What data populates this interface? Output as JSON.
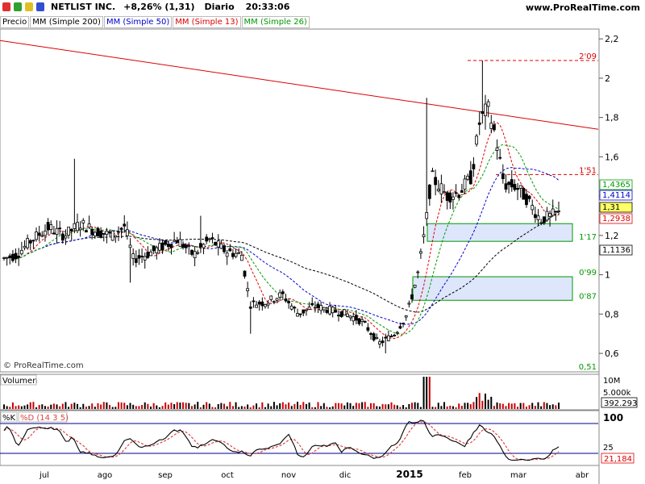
{
  "header": {
    "ticker": "NETLIST INC.",
    "change": "+8,26% (1,31)",
    "period": "Diario",
    "time": "20:33:06",
    "site": "www.ProRealTime.com",
    "icon_colors": [
      "#e03030",
      "#30a030",
      "#e0c020",
      "#3050d0"
    ]
  },
  "legend": [
    {
      "label": "Precio",
      "color": "#000000"
    },
    {
      "label": "MM (Simple 200)",
      "color": "#000000"
    },
    {
      "label": "MM (Simple 50)",
      "color": "#0000cc"
    },
    {
      "label": "MM (Simple 13)",
      "color": "#dd0000"
    },
    {
      "label": "MM (Simple 26)",
      "color": "#009900"
    }
  ],
  "watermark": "© ProRealTime.com",
  "chart_data": [
    {
      "type": "candlestick",
      "panel": "price",
      "y_ticks": [
        "0,6",
        "0,8",
        "1",
        "1,2",
        "1,4",
        "1,6",
        "1,8",
        "2",
        "2,2"
      ],
      "y_tick_values": [
        0.6,
        0.8,
        1.0,
        1.2,
        1.4,
        1.6,
        1.8,
        2.0,
        2.2
      ],
      "ylim": [
        0.51,
        2.25
      ],
      "x_labels": [
        "jul",
        "ago",
        "sep",
        "oct",
        "nov",
        "dic",
        "2015",
        "feb",
        "mar",
        "abr"
      ],
      "ohlc_approx": {
        "start_month": "jun",
        "segments": [
          {
            "label": "jun-jul",
            "range": [
              1.05,
              1.3
            ]
          },
          {
            "label": "ago",
            "range": [
              0.95,
              1.35
            ]
          },
          {
            "label": "sep-oct",
            "range": [
              0.7,
              1.25
            ]
          },
          {
            "label": "nov-dic",
            "range": [
              0.6,
              0.95
            ]
          },
          {
            "label": "ene",
            "range": [
              0.9,
              1.9
            ]
          },
          {
            "label": "feb",
            "range": [
              1.4,
              2.09
            ]
          },
          {
            "label": "mar",
            "range": [
              1.17,
              1.5
            ]
          }
        ],
        "last": 1.31,
        "high": 2.09
      },
      "price_labels": [
        {
          "text": "1,4365",
          "value": 1.4365,
          "color": "#009900",
          "style": "box"
        },
        {
          "text": "1,4114",
          "value": 1.4114,
          "color": "#0000cc",
          "style": "box"
        },
        {
          "text": "1,31",
          "value": 1.31,
          "color": "#000000",
          "style": "box-yellow"
        },
        {
          "text": "1,2938",
          "value": 1.2938,
          "color": "#dd0000",
          "style": "box"
        },
        {
          "text": "1,1136",
          "value": 1.1136,
          "color": "#000000",
          "style": "box"
        }
      ],
      "levels": [
        {
          "text": "2'09",
          "value": 2.09,
          "color": "#dd0000"
        },
        {
          "text": "1'51",
          "value": 1.51,
          "color": "#dd0000"
        },
        {
          "text": "1'17",
          "value": 1.17,
          "color": "#009900"
        },
        {
          "text": "0'99",
          "value": 0.99,
          "color": "#009900"
        },
        {
          "text": "0'87",
          "value": 0.87,
          "color": "#009900"
        },
        {
          "text": "0,51",
          "value": 0.51,
          "color": "#009900"
        }
      ],
      "zones": [
        {
          "from": 1.17,
          "to": 1.26,
          "start_month": "ene",
          "color": "#009900"
        },
        {
          "from": 0.87,
          "to": 0.99,
          "start_month": "ene",
          "color": "#009900"
        }
      ],
      "trendline": {
        "from_value": 2.2,
        "to_value": 1.74,
        "color": "#dd0000"
      },
      "series": [
        {
          "name": "MM (Simple 200)",
          "color": "#000000",
          "style": "dashed"
        },
        {
          "name": "MM (Simple 50)",
          "color": "#0000cc",
          "style": "dashed"
        },
        {
          "name": "MM (Simple 13)",
          "color": "#dd0000",
          "style": "dashed"
        },
        {
          "name": "MM (Simple 26)",
          "color": "#009900",
          "style": "dashed"
        }
      ]
    },
    {
      "type": "bar",
      "panel": "volume",
      "title": "Volumen",
      "y_ticks": [
        "10M",
        "5.000k"
      ],
      "last_value": "392.293",
      "max_bar": "ene"
    },
    {
      "type": "line",
      "panel": "stochastic",
      "labels": [
        {
          "text": "%K",
          "color": "#000000"
        },
        {
          "text": "%D (14 3 5)",
          "color": "#dd4444"
        }
      ],
      "y_ticks": [
        "100",
        "25"
      ],
      "last_value": "21,184",
      "last_value_color": "#dd0000"
    }
  ]
}
